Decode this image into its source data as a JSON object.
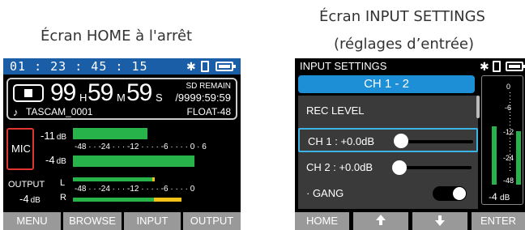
{
  "captions": {
    "home": "Écran HOME à l'arrêt",
    "input_line1": "Écran INPUT SETTINGS",
    "input_line2": "(réglages d’entrée)"
  },
  "home": {
    "time": "01 : 23 : 45 : 15",
    "status_icons": [
      "bluetooth-icon",
      "sd-card-icon",
      "battery-icon"
    ],
    "counter": {
      "hours": "99",
      "hours_unit": "H",
      "minutes": "59",
      "minutes_unit": "M",
      "seconds": "59",
      "seconds_unit": "S",
      "sd_remain_label": "SD REMAIN",
      "remain_time": "/9999:59:59",
      "file_icon": "music-note-icon",
      "file_name": "TASCAM_0001",
      "format": "FLOAT-48"
    },
    "mic": {
      "label": "MIC",
      "db1": "-11",
      "db2": "-4",
      "db_unit": "dB",
      "scale": "-48 · · -24 · · · -12 · · · · -6 · · · · 0 · 6",
      "level_1": -11,
      "level_2": -4
    },
    "output": {
      "label": "OUTPUT",
      "left": "L",
      "right": "R",
      "db": "-4",
      "db_unit": "dB",
      "scale": "-48 · · -24 · · · -12 · · · · -6 · · · · 0"
    },
    "softkeys": [
      "MENU",
      "BROWSE",
      "INPUT",
      "OUTPUT"
    ]
  },
  "input_settings": {
    "title": "INPUT SETTINGS",
    "channel_tab": "CH 1 - 2",
    "rec_level_header": "REC LEVEL",
    "ch1_label": "CH 1 : +0.0dB",
    "ch2_label": "CH 2 : +0.0dB",
    "gang_label": "· GANG",
    "gang_on": true,
    "meter_ticks": [
      "0",
      "-6",
      "-12",
      "-24",
      "-48"
    ],
    "meter_db": "-4",
    "meter_db_unit": "dB",
    "softkeys": [
      "HOME",
      "up-arrow-icon",
      "down-arrow-icon",
      "ENTER"
    ]
  },
  "colors": {
    "status_bar": "#1a5ea7",
    "meter_green": "#27b24a",
    "meter_yellow": "#f2c21b",
    "highlight_blue": "#1c8fd6",
    "mic_red": "#e0342f",
    "softkey_gray": "#999999"
  }
}
